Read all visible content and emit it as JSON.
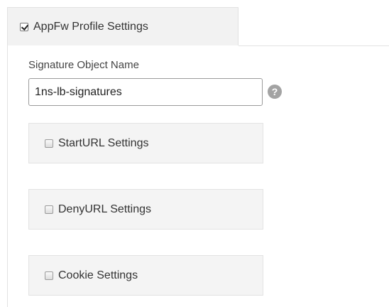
{
  "tab": {
    "label": "AppFw Profile Settings",
    "checked": true
  },
  "signature": {
    "label": "Signature Object Name",
    "value": "1ns-lb-signatures",
    "help_icon": "?"
  },
  "sections": [
    {
      "label": "StartURL Settings",
      "checked": false
    },
    {
      "label": "DenyURL Settings",
      "checked": false
    },
    {
      "label": "Cookie Settings",
      "checked": false
    }
  ]
}
